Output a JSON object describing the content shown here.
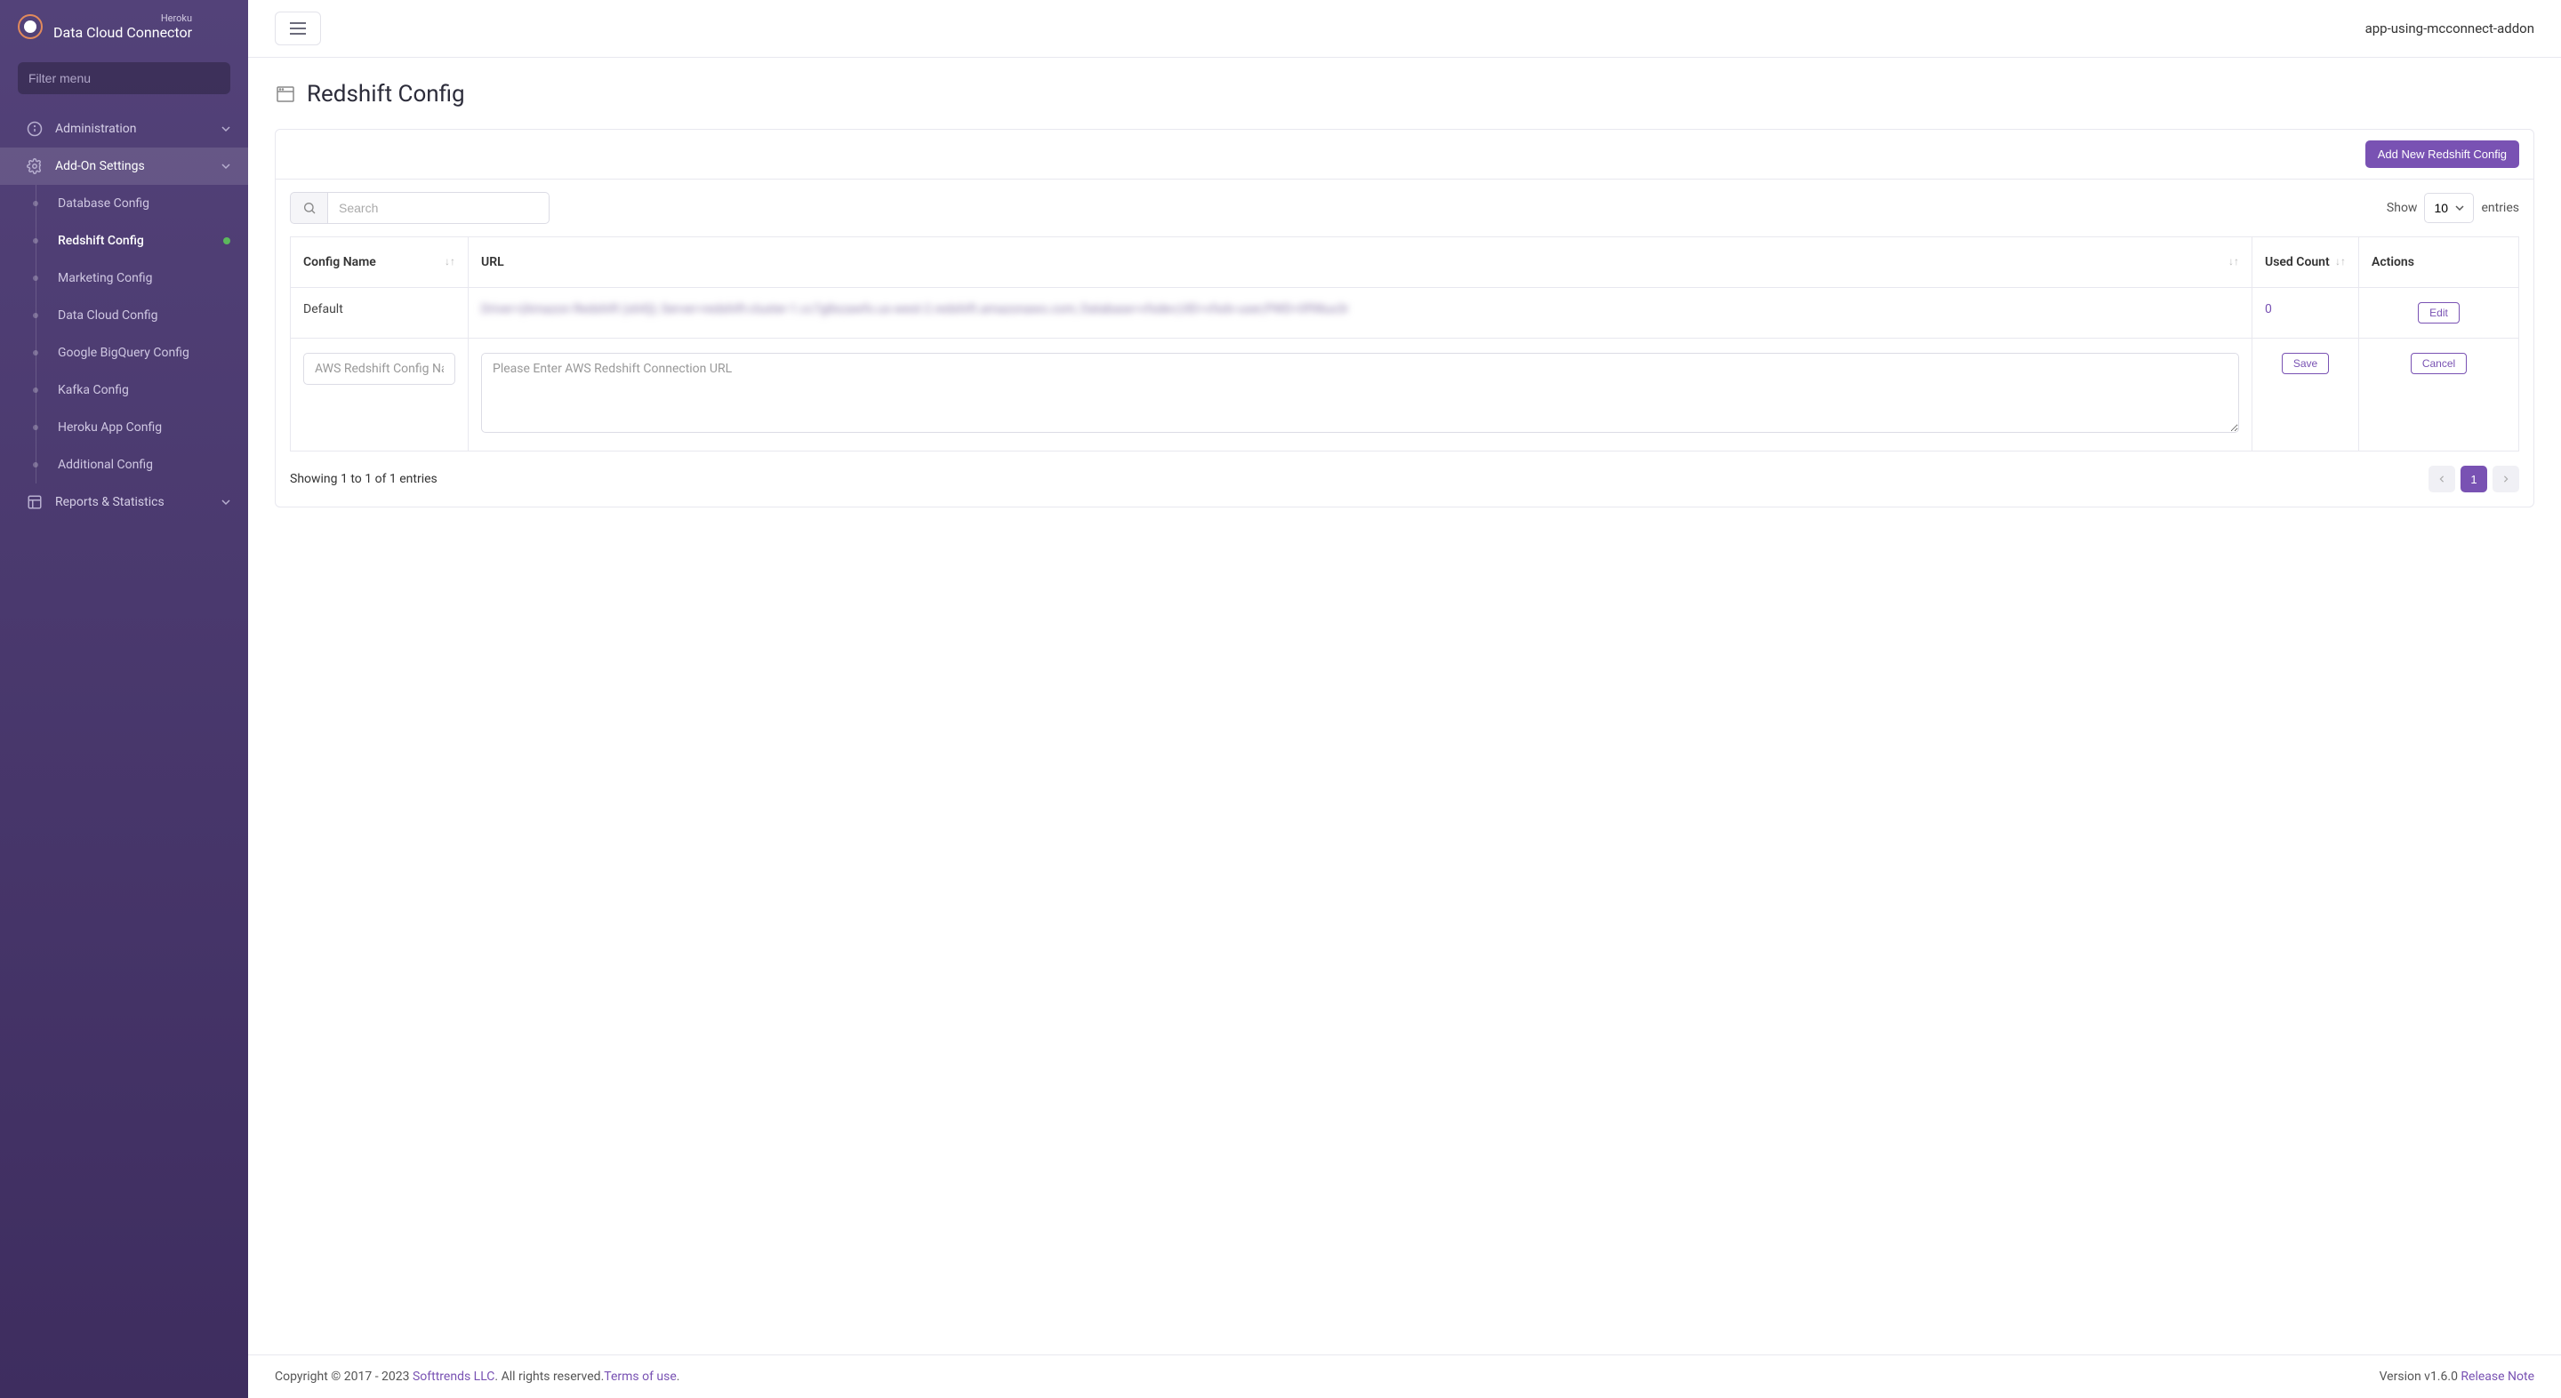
{
  "brand": {
    "super": "Heroku",
    "title": "Data Cloud Connector"
  },
  "sidebar": {
    "filter_placeholder": "Filter menu",
    "items": [
      {
        "label": "Administration"
      },
      {
        "label": "Add-On Settings"
      },
      {
        "label": "Reports & Statistics"
      }
    ],
    "sub_items": [
      {
        "label": "Database Config"
      },
      {
        "label": "Redshift Config"
      },
      {
        "label": "Marketing Config"
      },
      {
        "label": "Data Cloud Config"
      },
      {
        "label": "Google BigQuery Config"
      },
      {
        "label": "Kafka Config"
      },
      {
        "label": "Heroku App Config"
      },
      {
        "label": "Additional Config"
      }
    ]
  },
  "topbar": {
    "app_name": "app-using-mcconnect-addon"
  },
  "page": {
    "title": "Redshift Config"
  },
  "card": {
    "add_button": "Add New Redshift Config",
    "search_placeholder": "Search",
    "show_label": "Show",
    "entries_label": "entries",
    "show_value": "10"
  },
  "table": {
    "headers": {
      "config_name": "Config Name",
      "url": "URL",
      "used_count": "Used Count",
      "actions": "Actions"
    },
    "rows": [
      {
        "config_name": "Default",
        "url": "Driver={Amazon Redshift (x64)}; Server=redshift-cluster-1.cc7g8xzawfo.us-west-2.redshift.amazonaws.com; Database=vfxdev;UID=vfxdv-user;PWD=0f98ux3r",
        "used_count": "0",
        "edit": "Edit"
      }
    ],
    "new_row": {
      "name_placeholder": "AWS Redshift Config Name",
      "url_placeholder": "Please Enter AWS Redshift Connection URL",
      "save": "Save",
      "cancel": "Cancel"
    },
    "info": "Showing 1 to 1 of 1 entries",
    "page_current": "1"
  },
  "footer": {
    "copyright_prefix": "Copyright © 2017 - 2023 ",
    "company": "Softtrends LLC",
    "rights": ". All rights reserved.",
    "terms": "Terms of use",
    "period": ".",
    "version_prefix": "Version v1.6.0 ",
    "release_note": " Release Note"
  }
}
